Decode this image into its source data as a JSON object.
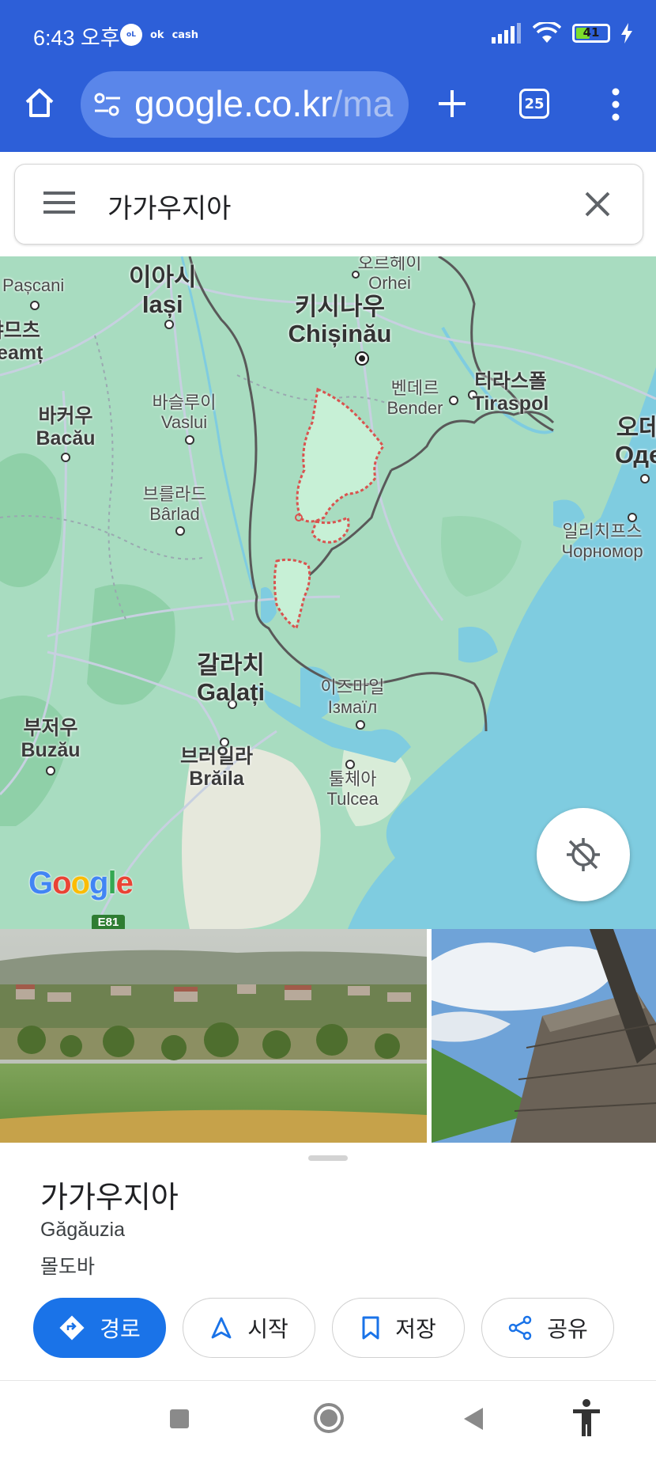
{
  "status_bar": {
    "time": "6:43 오후",
    "badges": [
      "oL",
      "ok",
      "cash"
    ],
    "battery": "41"
  },
  "browser": {
    "url_main": "google.co.kr",
    "url_tail": "/ma",
    "tab_count": "25"
  },
  "search": {
    "query": "가가우지아"
  },
  "map": {
    "labels": [
      {
        "ko": "오르헤이",
        "en": "Orhei"
      },
      {
        "ko": "이아시",
        "en": "Iași"
      },
      {
        "ko": "키시나우",
        "en": "Chișinău"
      },
      {
        "ko": "벤데르",
        "en": "Bender"
      },
      {
        "ko": "티라스폴",
        "en": "Tiraspol"
      },
      {
        "ko": "오데",
        "en": "Оде"
      },
      {
        "ko": "바슬루이",
        "en": "Vaslui"
      },
      {
        "ko": "바커우",
        "en": "Bacău"
      },
      {
        "ko": "브를라드",
        "en": "Bârlad"
      },
      {
        "ko": "일리치프스",
        "en": "Чорномор"
      },
      {
        "ko": "갈라치",
        "en": "Galați"
      },
      {
        "ko": "이즈마일",
        "en": "Ізмаїл"
      },
      {
        "ko": "부저우",
        "en": "Buzău"
      },
      {
        "ko": "브러일라",
        "en": "Brăila"
      },
      {
        "ko": "툴체아",
        "en": "Tulcea"
      },
      {
        "ko": "",
        "en": "Pașcani"
      },
      {
        "ko": "냐므츠",
        "en": "Neamț"
      }
    ],
    "road_shield": "E81",
    "logo": "Google"
  },
  "place": {
    "name": "가가우지아",
    "native_name": "Găgăuzia",
    "country": "몰도바"
  },
  "actions": [
    {
      "label": "경로",
      "icon": "directions-icon"
    },
    {
      "label": "시작",
      "icon": "navigation-arrow-icon"
    },
    {
      "label": "저장",
      "icon": "bookmark-icon"
    },
    {
      "label": "공유",
      "icon": "share-icon"
    }
  ],
  "colors": {
    "chrome_blue": "#2d5fd8",
    "primary": "#1a73e8",
    "map_land": "#a8dcc0",
    "map_water": "#7fcce0",
    "region_outline": "#d9534f"
  }
}
